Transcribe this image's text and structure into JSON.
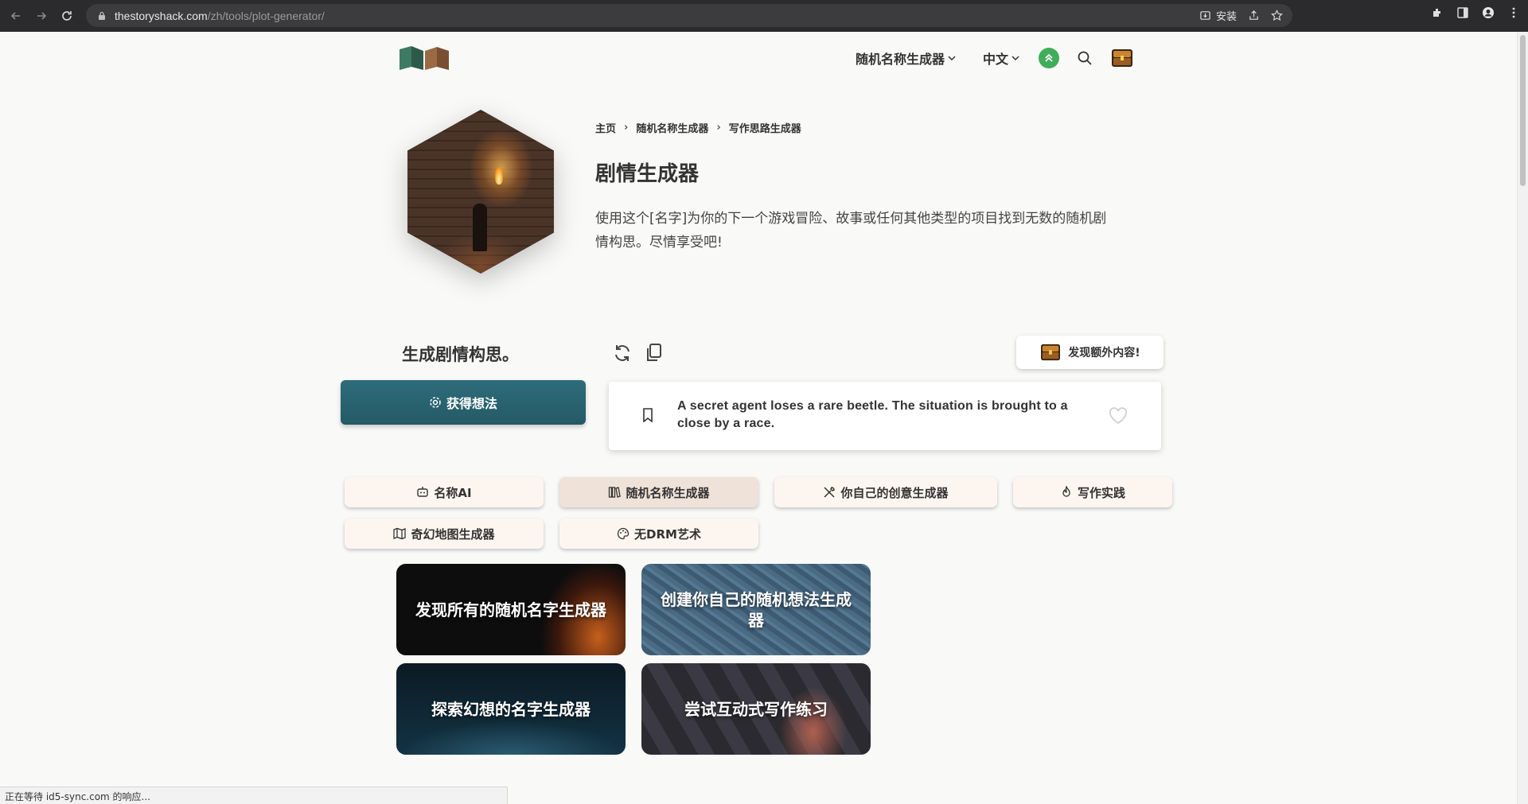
{
  "browser": {
    "url_host": "thestoryshack.com",
    "url_path": "/zh/tools/plot-generator/",
    "install_label": "安装"
  },
  "header": {
    "nav_generators": "随机名称生成器",
    "nav_language": "中文"
  },
  "breadcrumb": [
    "主页",
    "随机名称生成器",
    "写作思路生成器"
  ],
  "page": {
    "title": "剧情生成器",
    "description": "使用这个[名字]为你的下一个游戏冒险、故事或任何其他类型的项目找到无数的随机剧情构思。尽情享受吧!"
  },
  "generator": {
    "heading": "生成剧情构思。",
    "extra_label": "发现额外内容!",
    "get_button": "获得想法",
    "result": "A secret agent loses a rare beetle. The situation is brought to a close by a race."
  },
  "tools": [
    {
      "label": "名称AI",
      "icon": "robot-icon"
    },
    {
      "label": "随机名称生成器",
      "icon": "books-icon"
    },
    {
      "label": "你自己的创意生成器",
      "icon": "tools-icon"
    },
    {
      "label": "写作实践",
      "icon": "flame-icon"
    },
    {
      "label": "奇幻地图生成器",
      "icon": "map-icon"
    },
    {
      "label": "无DRM艺术",
      "icon": "palette-icon"
    }
  ],
  "cards": [
    {
      "label": "发现所有的随机名字生成器"
    },
    {
      "label": "创建你自己的随机想法生成器"
    },
    {
      "label": "探索幻想的名字生成器"
    },
    {
      "label": "尝试互动式写作练习"
    }
  ],
  "status": "正在等待 id5-sync.com 的响应..."
}
